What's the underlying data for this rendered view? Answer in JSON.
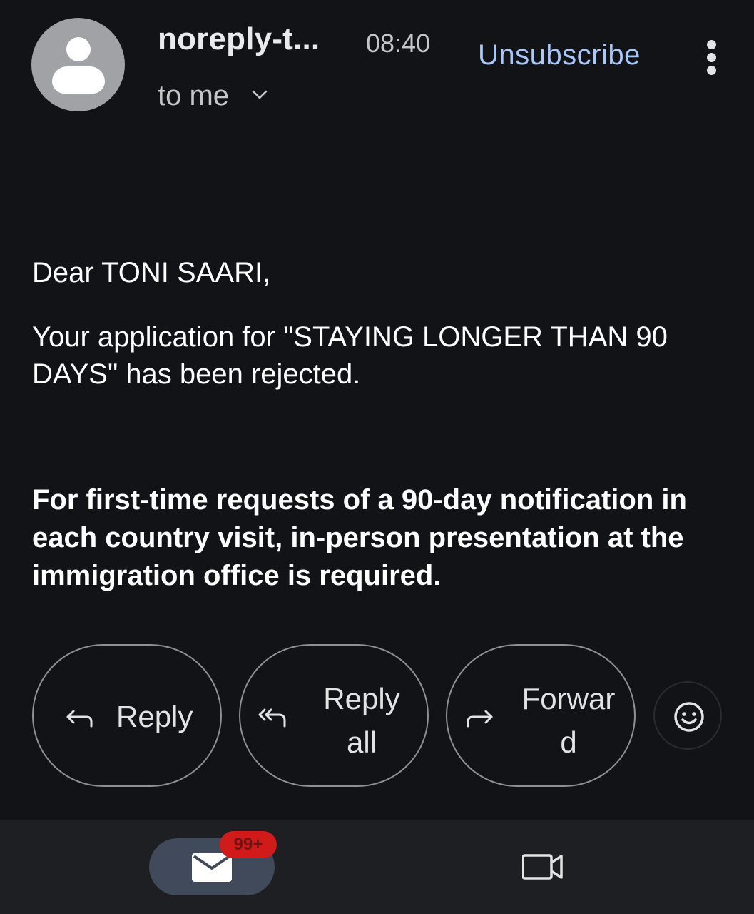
{
  "header": {
    "sender": "noreply-t...",
    "time": "08:40",
    "unsubscribe_label": "Unsubscribe",
    "recipient_label": "to me"
  },
  "message": {
    "greeting": "Dear TONI SAARI,",
    "body": "Your application for \"STAYING LONGER THAN 90 DAYS\" has been rejected.",
    "notice": "For first-time requests of a 90-day notification in each country visit, in-person presentation at the immigration office is required."
  },
  "actions": {
    "reply": "Reply",
    "reply_all_line1": "Reply",
    "reply_all_line2": "all",
    "forward_line1": "Forwar",
    "forward_line2": "d"
  },
  "bottom_nav": {
    "mail_badge": "99+"
  },
  "icons": {
    "avatar": "person-icon",
    "more": "more-vert-icon",
    "expand": "chevron-down-icon",
    "reply": "reply-icon",
    "reply_all": "reply-all-icon",
    "forward": "forward-icon",
    "emoji": "emoji-icon",
    "mail": "mail-icon",
    "meet": "video-icon"
  },
  "colors": {
    "background": "#121317",
    "link": "#a8c7fa",
    "badge": "#d11a1a",
    "nav_active": "#414a5a"
  }
}
